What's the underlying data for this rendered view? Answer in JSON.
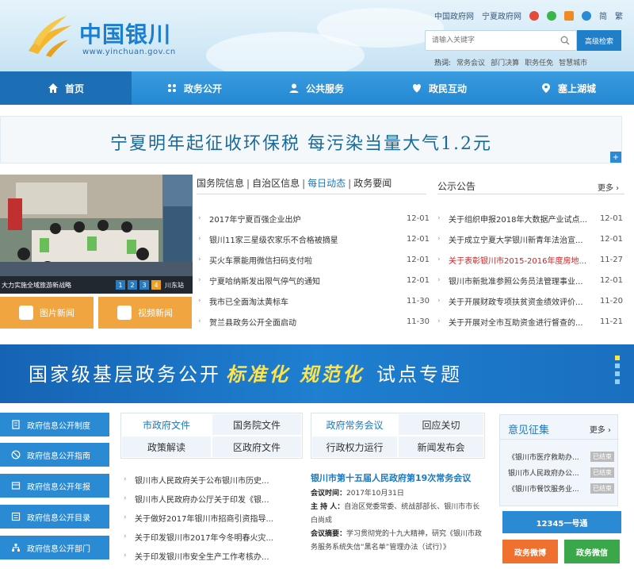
{
  "header": {
    "logo_text": "中国银川",
    "logo_url": "www.yinchuan.gov.cn",
    "top_links": [
      "中国政府网",
      "宁夏政府网"
    ],
    "lang": [
      "简",
      "繁"
    ],
    "search_placeholder": "请输入关键字",
    "advanced_search": "高级检索",
    "hot_label": "热词:",
    "hot_words": [
      "常务会议",
      "部门决算",
      "职务任免",
      "智慧城市"
    ]
  },
  "nav": [
    {
      "label": "首页",
      "icon": "home-icon"
    },
    {
      "label": "政务公开",
      "icon": "dots-icon"
    },
    {
      "label": "公共服务",
      "icon": "user-icon"
    },
    {
      "label": "政民互动",
      "icon": "heart-icon"
    },
    {
      "label": "塞上湖城",
      "icon": "pin-icon"
    }
  ],
  "banner": {
    "text": "宁夏明年起征收环保税  每污染当量大气1.2元",
    "plus": "+"
  },
  "photo": {
    "caption": "大力实施全域旅游新战略",
    "dots": [
      "1",
      "2",
      "3",
      "4"
    ],
    "caption2": "川东站"
  },
  "media": {
    "picture_news": "图片新闻",
    "video_news": "视频新闻"
  },
  "news_tabs": [
    "国务院信息",
    "自治区信息",
    "每日动态",
    "政务要闻"
  ],
  "news": [
    {
      "title": "2017年宁夏百强企业出炉",
      "date": "12-01"
    },
    {
      "title": "银川11家三星级农家乐不合格被摘星",
      "date": "12-01"
    },
    {
      "title": "买火车票能用微信扫码支付啦",
      "date": "12-01"
    },
    {
      "title": "宁夏哈纳斯发出限气停气的通知",
      "date": "12-01"
    },
    {
      "title": "我市已全面淘汰黄标车",
      "date": "11-30"
    },
    {
      "title": "贺兰县政务公开全面启动",
      "date": "11-30"
    }
  ],
  "notice": {
    "title": "公示公告",
    "more": "更多 ›",
    "items": [
      {
        "title": "关于组织申报2018年大数据产业试点...",
        "date": "12-01"
      },
      {
        "title": "关于成立宁夏大学银川新青年法治宣...",
        "date": "12-01"
      },
      {
        "title": "关于表彰银川市2015-2016年度房地...",
        "date": "11-27",
        "highlight": true
      },
      {
        "title": "银川市新批准参照公务员法管理事业...",
        "date": "12-01"
      },
      {
        "title": "关于开展财政专项扶贫资金绩效评价...",
        "date": "11-20"
      },
      {
        "title": "关于开展对全市互助资金进行督查的...",
        "date": "11-21"
      }
    ]
  },
  "special": {
    "part1": "国家级基层政务公开",
    "part2": "标准化",
    "part3": "规范化",
    "part4": "试点专题"
  },
  "left_menu": [
    {
      "label": "政府信息公开制度",
      "icon": "doc-icon"
    },
    {
      "label": "政府信息公开指南",
      "icon": "compass-icon"
    },
    {
      "label": "政府信息公开年报",
      "icon": "report-icon"
    },
    {
      "label": "政府信息公开目录",
      "icon": "list-icon"
    },
    {
      "label": "政府信息公开部门",
      "icon": "org-icon"
    }
  ],
  "doc_tabs": [
    "市政府文件",
    "国务院文件",
    "政策解读",
    "区政府文件"
  ],
  "docs": [
    "银川市人民政府关于公布银川市历史...",
    "银川市人民政府办公厅关于印发《银...",
    "关于做好2017年银川市招商引资指导...",
    "关于印发银川市2017年今冬明春火灾...",
    "关于印发银川市安全生产工作考核办..."
  ],
  "meet_tabs": [
    "政府常务会议",
    "回应关切",
    "行政权力运行",
    "新闻发布会"
  ],
  "meeting": {
    "title": "银川市第十五届人民政府第19次常务会议",
    "time_label": "会议时间：",
    "time": "2017年10月31日",
    "host_label": "主 持 人：",
    "host": "自治区党委常委、统战部部长、银川市市长白尚成",
    "summary_label": "会议摘要：",
    "summary": "学习贯彻党的十九大精神，研究《银川市政务服务系统失信“黑名单”管理办法（试行）》"
  },
  "opinion": {
    "title": "意见征集",
    "more": "更多 ›",
    "items": [
      {
        "title": "《银川市医疗救助办...",
        "badge": "已结束"
      },
      {
        "title": "银川市人民政府办公...",
        "badge": "已结束"
      },
      {
        "title": "《银川市餐饮服务业...",
        "badge": "已结束"
      }
    ]
  },
  "hotline": "12345一号通",
  "gov_weibo": "政务微博",
  "gov_wechat": "政务微信",
  "colors": {
    "primary": "#2a8ad4",
    "nav": "#2387d2",
    "accent": "#f0a541",
    "highlight": "#d42020"
  }
}
